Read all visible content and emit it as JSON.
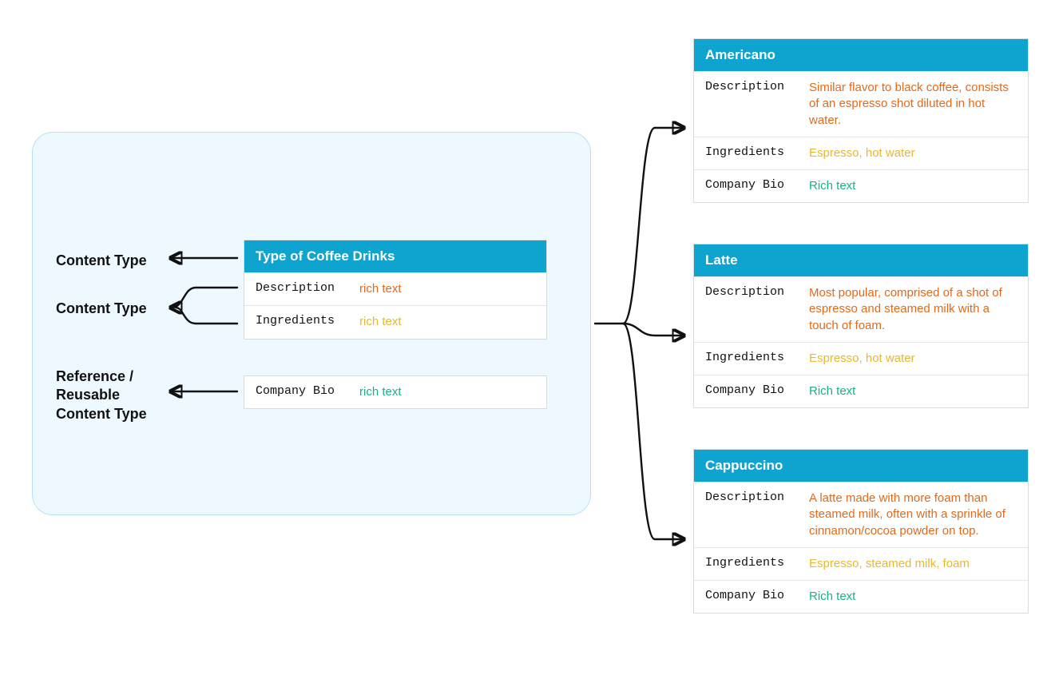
{
  "labels": {
    "content_type_1": "Content Type",
    "content_type_2": "Content Type",
    "reference": "Reference / Reusable Content Type"
  },
  "main_card": {
    "title": "Type of Coffee Drinks",
    "rows": [
      {
        "key": "Description",
        "val": "rich text",
        "color": "c-orange"
      },
      {
        "key": "Ingredients",
        "val": "rich text",
        "color": "c-yellow"
      }
    ]
  },
  "reference_card": {
    "rows": [
      {
        "key": "Company Bio",
        "val": "rich text",
        "color": "c-teal"
      }
    ]
  },
  "instances": [
    {
      "title": "Americano",
      "rows": [
        {
          "key": "Description",
          "val": "Similar flavor to black coffee, consists of an espresso shot diluted in hot water.",
          "color": "c-orange"
        },
        {
          "key": "Ingredients",
          "val": "Espresso, hot water",
          "color": "c-yellow"
        },
        {
          "key": "Company Bio",
          "val": "Rich text",
          "color": "c-teal"
        }
      ]
    },
    {
      "title": "Latte",
      "rows": [
        {
          "key": "Description",
          "val": "Most popular, comprised of a shot of espresso and steamed milk with a touch of foam.",
          "color": "c-orange"
        },
        {
          "key": "Ingredients",
          "val": "Espresso, hot water",
          "color": "c-yellow"
        },
        {
          "key": "Company Bio",
          "val": "Rich text",
          "color": "c-teal"
        }
      ]
    },
    {
      "title": "Cappuccino",
      "rows": [
        {
          "key": "Description",
          "val": "A latte made with more foam than steamed milk, often with a sprinkle of cinnamon/cocoa powder on top.",
          "color": "c-orange"
        },
        {
          "key": "Ingredients",
          "val": "Espresso, steamed milk, foam",
          "color": "c-yellow"
        },
        {
          "key": "Company Bio",
          "val": "Rich text",
          "color": "c-teal"
        }
      ]
    }
  ]
}
